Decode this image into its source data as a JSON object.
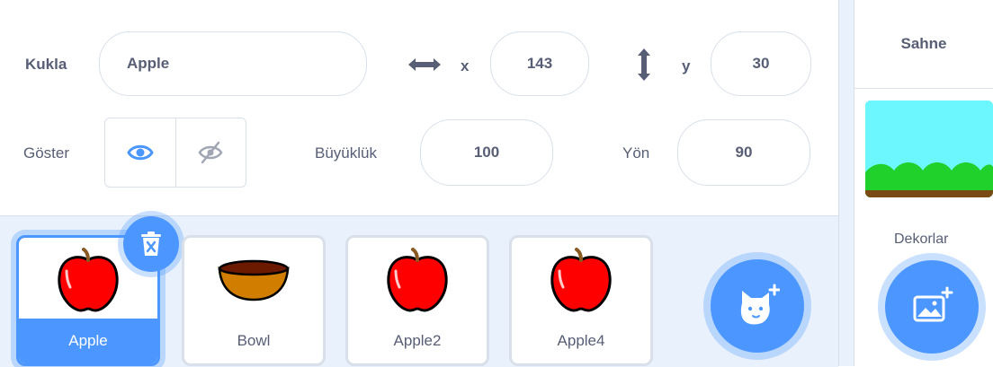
{
  "sprite_info": {
    "sprite_label": "Kukla",
    "sprite_name": "Apple",
    "x_label": "x",
    "x_value": "143",
    "y_label": "y",
    "y_value": "30",
    "show_label": "Göster",
    "show_visible_icon": "eye-icon",
    "show_hidden_icon": "eye-slash-icon",
    "size_label": "Büyüklük",
    "size_value": "100",
    "direction_label": "Yön",
    "direction_value": "90"
  },
  "sprites": [
    {
      "name": "Apple",
      "icon": "apple-icon",
      "selected": true
    },
    {
      "name": "Bowl",
      "icon": "bowl-icon",
      "selected": false
    },
    {
      "name": "Apple2",
      "icon": "apple-icon",
      "selected": false
    },
    {
      "name": "Apple4",
      "icon": "apple-icon",
      "selected": false
    }
  ],
  "stage": {
    "title": "Sahne",
    "backdrops_label": "Dekorlar"
  },
  "colors": {
    "accent": "#4c97ff",
    "text": "#575e75",
    "pane_bg": "#e9f1fc",
    "apple_red": "#ff0000",
    "bowl_brown": "#d17d00"
  }
}
